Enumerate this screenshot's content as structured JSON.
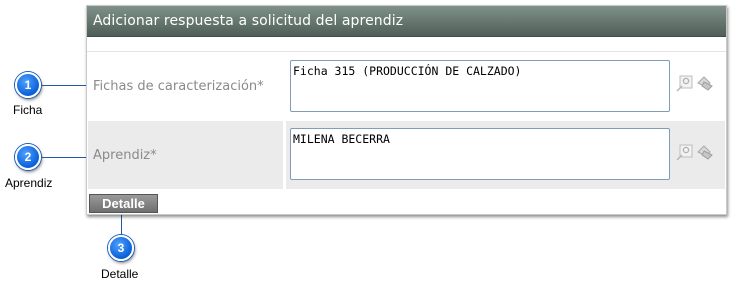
{
  "panel": {
    "title": "Adicionar respuesta a solicitud del aprendiz"
  },
  "fields": [
    {
      "label": "Fichas de caracterización*",
      "value": "Ficha 315 (PRODUCCIÓN DE CALZADO)",
      "icons": [
        "search-icon",
        "erase-icon"
      ]
    },
    {
      "label": "Aprendiz*",
      "value": "MILENA BECERRA",
      "icons": [
        "search-icon",
        "erase-icon"
      ]
    }
  ],
  "detail_button": {
    "label": "Detalle"
  },
  "callouts": [
    {
      "number": "1",
      "caption": "Ficha"
    },
    {
      "number": "2",
      "caption": "Aprendiz"
    },
    {
      "number": "3",
      "caption": "Detalle"
    }
  ],
  "colors": {
    "header": "#5f7069",
    "callout": "#1a73e8",
    "button": "#808080"
  }
}
